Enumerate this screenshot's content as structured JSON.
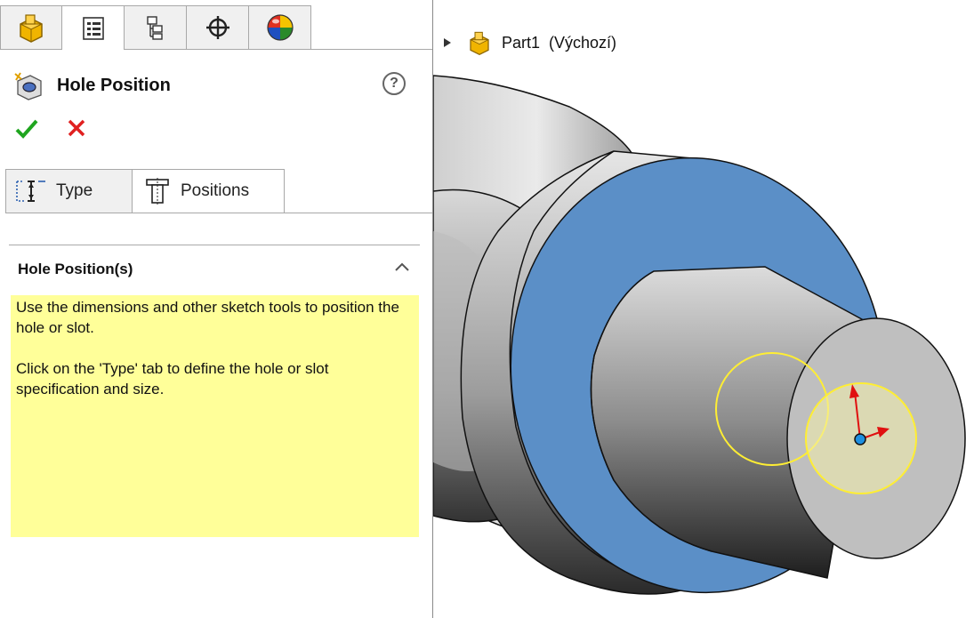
{
  "manager_tabs": [
    {
      "name": "FeatureManager",
      "icon": "part-icon",
      "active": false
    },
    {
      "name": "PropertyManager",
      "icon": "property-manager-icon",
      "active": true
    },
    {
      "name": "ConfigurationManager",
      "icon": "configuration-manager-icon",
      "active": false
    },
    {
      "name": "DimXpertManager",
      "icon": "dimxpert-icon",
      "active": false
    },
    {
      "name": "DisplayManager",
      "icon": "display-manager-icon",
      "active": false
    }
  ],
  "property_manager": {
    "title": "Hole Position",
    "help_label": "?"
  },
  "actions": {
    "ok_icon": "checkmark-icon",
    "cancel_icon": "x-icon"
  },
  "sub_tabs": {
    "type_label": "Type",
    "positions_label": "Positions",
    "active": "Positions"
  },
  "section": {
    "title": "Hole Position(s)",
    "message_line1": "Use the dimensions and other sketch tools to position the hole or slot.",
    "message_line2": "Click on the 'Type' tab to define the hole or slot specification and size."
  },
  "tree": {
    "item_label": "Part1  (Výchozí)"
  },
  "colors": {
    "accent_face": "#5b8fc7",
    "sketch_circle": "#ffee33",
    "ok": "#1fa51f",
    "cancel": "#e02020",
    "message_bg": "#ffff99"
  }
}
